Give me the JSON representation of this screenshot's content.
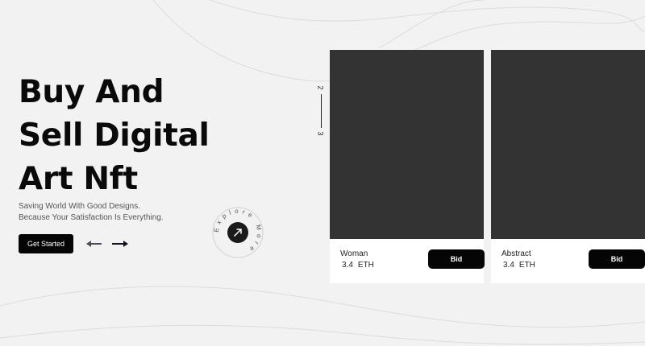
{
  "hero": {
    "title_lines": [
      "Buy And",
      "Sell Digital",
      "Art Nft"
    ],
    "subtitle_lines": [
      "Saving World With Good Designs.",
      "Because Your Satisfaction Is Everything."
    ],
    "cta_label": "Get Started"
  },
  "navigation": {
    "prev_icon": "arrow-left-icon",
    "next_icon": "arrow-right-icon"
  },
  "explore_badge": {
    "text": "Explore More",
    "icon": "arrow-up-right-icon"
  },
  "pager": {
    "current": "2",
    "next": "3"
  },
  "cards": [
    {
      "name": "Woman",
      "price": "3.4",
      "currency": "ETH",
      "bid_label": "Bid"
    },
    {
      "name": "Abstract",
      "price": "3.4",
      "currency": "ETH",
      "bid_label": "Bid"
    }
  ],
  "colors": {
    "background": "#f2f2f2",
    "dark": "#050505",
    "card_image": "#333333",
    "card_body": "#ffffff"
  }
}
